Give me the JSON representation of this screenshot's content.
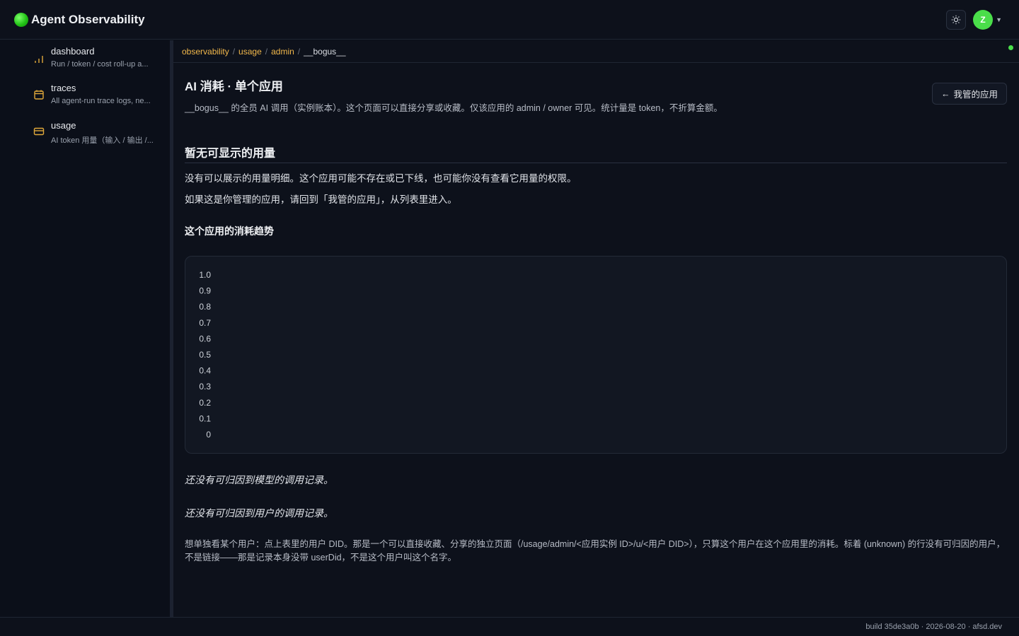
{
  "app": {
    "title": "Agent Observability",
    "logo_icon": "green-orb-icon",
    "accent": "#f2b84b"
  },
  "topbar": {
    "theme_icon": "sun-icon",
    "avatar_letter": "Z",
    "avatar_color": "#4ade4a"
  },
  "sidebar": {
    "items": [
      {
        "title": "dashboard",
        "desc": "Run / token / cost roll-up a...",
        "icon": "bar-chart-icon"
      },
      {
        "title": "traces",
        "desc": "All agent-run trace logs, ne...",
        "icon": "calendar-icon"
      },
      {
        "title": "usage",
        "desc": "AI token 用量（输入 / 输出 /...",
        "icon": "credit-card-icon"
      }
    ]
  },
  "breadcrumb": {
    "items": [
      "observability",
      "usage",
      "admin"
    ],
    "current": "__bogus__"
  },
  "header": {
    "title": "AI 消耗 · 单个应用",
    "subtitle": "__bogus__ 的全员 AI 调用（实例账本）。这个页面可以直接分享或收藏。仅该应用的 admin / owner 可见。统计量是 token，不折算金额。",
    "back_button": "我管的应用"
  },
  "empty": {
    "title": "暂无可显示的用量",
    "para1": "没有可以展示的用量明细。这个应用可能不存在或已下线，也可能你没有查看它用量的权限。",
    "para2": "如果这是你管理的应用，请回到「我管的应用」，从列表里进入。"
  },
  "trend": {
    "title": "这个应用的消耗趋势"
  },
  "chart_data": {
    "type": "line",
    "series": [],
    "yticks": [
      "1.0",
      "0.9",
      "0.8",
      "0.7",
      "0.6",
      "0.5",
      "0.4",
      "0.3",
      "0.2",
      "0.1",
      "0"
    ],
    "ylim": [
      0,
      1
    ]
  },
  "notes": {
    "no_model": "还没有可归因到模型的调用记录。",
    "no_user": "还没有可归因到用户的调用记录。",
    "footnote": "想单独看某个用户：点上表里的用户 DID。那是一个可以直接收藏、分享的独立页面（/usage/admin/<应用实例 ID>/u/<用户 DID>），只算这个用户在这个应用里的消耗。标着 (unknown) 的行没有可归因的用户，不是链接——那是记录本身没带 userDid，不是这个用户叫这个名字。"
  },
  "footer": {
    "build": "build 35de3a0b · 2026-08-20 · afsd.dev"
  }
}
